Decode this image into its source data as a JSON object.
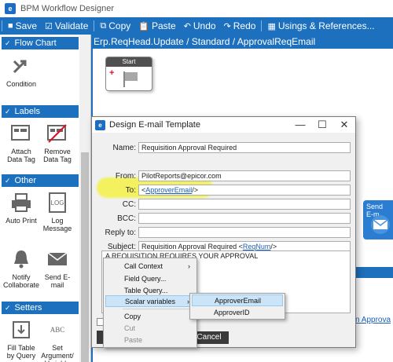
{
  "app": {
    "title": "BPM Workflow Designer",
    "icon": "e"
  },
  "toolbar": {
    "save": "Save",
    "validate": "Validate",
    "copy": "Copy",
    "paste": "Paste",
    "undo": "Undo",
    "redo": "Redo",
    "usings": "Usings & References..."
  },
  "sidebar": {
    "flow_chart": "Flow Chart",
    "condition": "Condition",
    "labels": "Labels",
    "attach_data_tag": "Attach Data Tag",
    "remove_data_tag": "Remove Data Tag",
    "other": "Other",
    "auto_print": "Auto Print",
    "log_message": "Log Message",
    "log_badge": "LOG",
    "notify_collaborate": "Notify Collaborate",
    "send_email": "Send E-mail",
    "setters": "Setters",
    "fill_table": "Fill Table by Query",
    "set_argument": "Set Argument/ Variable",
    "abc_badge": "ABC"
  },
  "canvas": {
    "breadcrumb": "Erp.ReqHead.Update / Standard / ApprovalReqEmail",
    "start_label": "Start",
    "send_node_label": "Send E-m",
    "approval_link": "n Approva"
  },
  "dialog": {
    "title": "Design E-mail Template",
    "name_label": "Name:",
    "name_value": "Requisition Approval Required",
    "from_label": "From:",
    "from_value": "PilotReports@epicor.com",
    "to_label": "To:",
    "to_value_prefix": "<",
    "to_value_link": "ApproverEmail",
    "to_value_suffix": "/>",
    "cc_label": "CC:",
    "cc_value": "",
    "bcc_label": "BCC:",
    "bcc_value": "",
    "replyto_label": "Reply to:",
    "replyto_value": "",
    "subject_label": "Subject:",
    "subject_prefix": "Requisition Approval Required <",
    "subject_link": "ReqNum",
    "subject_suffix": "/>",
    "body_text": "A REQUISITION REQUIRES YOUR APPROVAL",
    "cancel": "Cancel"
  },
  "context_menu": {
    "items": [
      "Call Context",
      "Field Query...",
      "Table Query...",
      "Scalar variables",
      "Copy",
      "Cut",
      "Paste"
    ]
  },
  "submenu": {
    "items": [
      "ApproverEmail",
      "ApproverID"
    ]
  }
}
